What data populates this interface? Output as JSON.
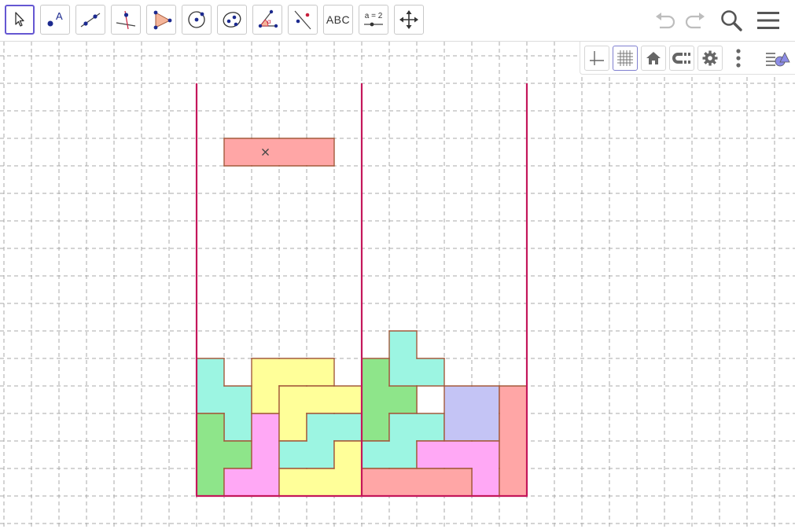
{
  "toolbar": {
    "tools": [
      {
        "name": "move",
        "icon": "cursor-arrow-icon",
        "selected": true
      },
      {
        "name": "point",
        "icon": "point-icon",
        "label": "A"
      },
      {
        "name": "line",
        "icon": "line-through-points-icon"
      },
      {
        "name": "perpendicular",
        "icon": "perpendicular-line-icon"
      },
      {
        "name": "polygon",
        "icon": "polygon-icon"
      },
      {
        "name": "circle",
        "icon": "circle-center-point-icon"
      },
      {
        "name": "ellipse",
        "icon": "ellipse-icon"
      },
      {
        "name": "angle",
        "icon": "angle-icon",
        "label": "α"
      },
      {
        "name": "reflect",
        "icon": "reflect-about-line-icon"
      },
      {
        "name": "text",
        "icon": "text-icon",
        "label": "ABC"
      },
      {
        "name": "slider",
        "icon": "slider-icon",
        "label": "a = 2"
      },
      {
        "name": "move-graphics",
        "icon": "move-graphics-view-icon"
      }
    ],
    "right": [
      "undo-icon",
      "redo-icon",
      "search-icon",
      "menu-icon"
    ]
  },
  "style_bar": [
    "axes-toggle-icon",
    "grid-toggle-icon",
    "home-icon",
    "point-capturing-icon",
    "gear-icon",
    "more-vertical-icon",
    "style-bar-toggle-icon"
  ],
  "colors": {
    "wall": "#c4175b",
    "grid_line": "#a8a8a8",
    "cyan": "#9cf5e2",
    "yellow": "#ffff99",
    "green": "#8ee58a",
    "pink": "#ffa8f5",
    "lavender": "#c4c4f5",
    "red": "#ffa6a6",
    "piece_border": "#a45a3c",
    "accent": "#6557d2"
  },
  "board": {
    "walls": [
      [
        7,
        2,
        7,
        17
      ],
      [
        13,
        2,
        13,
        17
      ],
      [
        19,
        2,
        19,
        17
      ]
    ],
    "floor": [
      7,
      17,
      19,
      17
    ],
    "pieces": [
      {
        "color": "red",
        "cells": [
          [
            8,
            4
          ],
          [
            9,
            4
          ],
          [
            10,
            4
          ],
          [
            11,
            4
          ]
        ],
        "marker": [
          9,
          4
        ]
      },
      {
        "color": "cyan",
        "cells": [
          [
            7,
            12
          ],
          [
            7,
            13
          ],
          [
            8,
            13
          ],
          [
            8,
            14
          ]
        ]
      },
      {
        "color": "green",
        "cells": [
          [
            7,
            14
          ],
          [
            7,
            15
          ],
          [
            7,
            16
          ],
          [
            8,
            15
          ]
        ]
      },
      {
        "color": "pink",
        "cells": [
          [
            9,
            14
          ],
          [
            9,
            15
          ],
          [
            9,
            16
          ],
          [
            8,
            16
          ]
        ]
      },
      {
        "color": "yellow",
        "cells": [
          [
            9,
            12
          ],
          [
            10,
            12
          ],
          [
            11,
            12
          ],
          [
            9,
            13
          ]
        ]
      },
      {
        "color": "yellow",
        "cells": [
          [
            10,
            13
          ],
          [
            11,
            13
          ],
          [
            12,
            13
          ],
          [
            10,
            14
          ]
        ]
      },
      {
        "color": "cyan",
        "cells": [
          [
            11,
            14
          ],
          [
            12,
            14
          ],
          [
            10,
            15
          ],
          [
            11,
            15
          ]
        ]
      },
      {
        "color": "yellow",
        "cells": [
          [
            12,
            15
          ],
          [
            10,
            16
          ],
          [
            11,
            16
          ],
          [
            12,
            16
          ]
        ]
      },
      {
        "color": "cyan",
        "cells": [
          [
            14,
            11
          ],
          [
            14,
            12
          ],
          [
            15,
            12
          ],
          [
            14,
            13
          ]
        ]
      },
      {
        "color": "green",
        "cells": [
          [
            13,
            12
          ],
          [
            13,
            13
          ],
          [
            13,
            14
          ],
          [
            14,
            13
          ]
        ]
      },
      {
        "color": "cyan",
        "cells": [
          [
            14,
            14
          ],
          [
            15,
            14
          ],
          [
            13,
            15
          ],
          [
            14,
            15
          ]
        ]
      },
      {
        "color": "lavender",
        "cells": [
          [
            16,
            13
          ],
          [
            17,
            13
          ],
          [
            16,
            14
          ],
          [
            17,
            14
          ]
        ]
      },
      {
        "color": "pink",
        "cells": [
          [
            15,
            15
          ],
          [
            16,
            15
          ],
          [
            17,
            15
          ],
          [
            17,
            16
          ]
        ]
      },
      {
        "color": "red",
        "cells": [
          [
            18,
            13
          ],
          [
            18,
            14
          ],
          [
            18,
            15
          ],
          [
            18,
            16
          ]
        ]
      },
      {
        "color": "red",
        "cells": [
          [
            13,
            16
          ],
          [
            14,
            16
          ],
          [
            15,
            16
          ],
          [
            16,
            16
          ]
        ]
      }
    ]
  }
}
